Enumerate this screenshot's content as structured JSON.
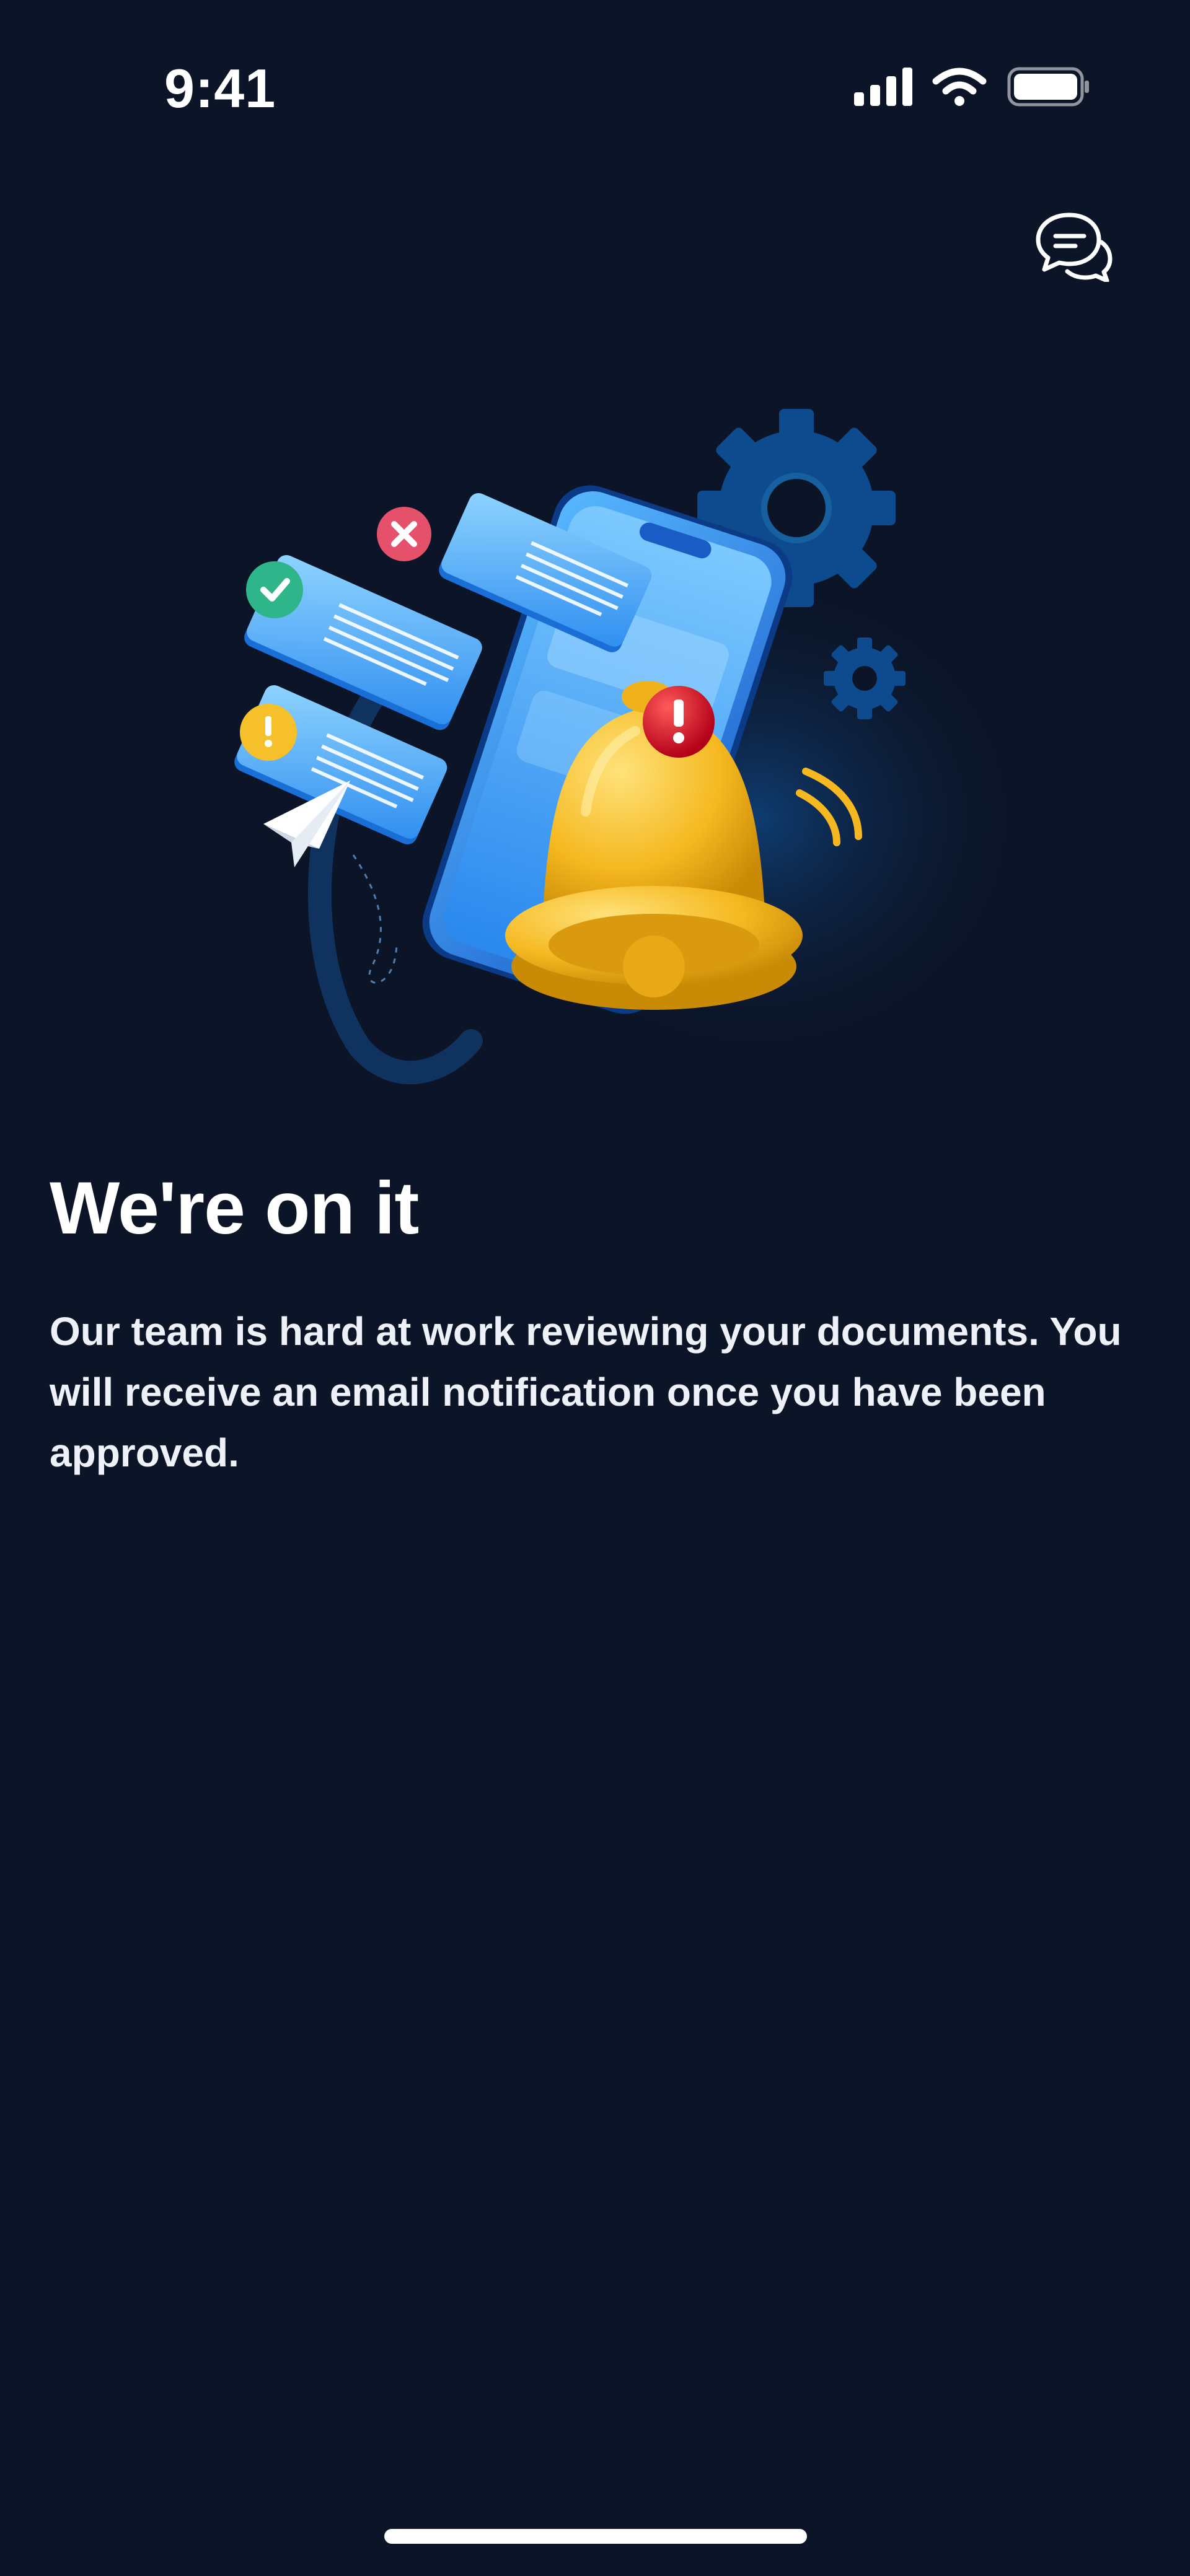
{
  "status_bar": {
    "time": "9:41",
    "icons": [
      "cellular-signal-icon",
      "wifi-icon",
      "battery-icon"
    ]
  },
  "header": {
    "chat_icon": "chat-bubbles-icon"
  },
  "illustration": {
    "subject": "notification-bell-phone-illustration",
    "elements": [
      "phone",
      "bell",
      "alert-badge",
      "message-cards",
      "status-check-icon",
      "status-cross-icon",
      "status-warning-icon",
      "paper-plane",
      "gears"
    ]
  },
  "content": {
    "title": "We're on it",
    "body": "Our team is hard at work reviewing your documents. You will receive an email notification once you have been approved."
  },
  "colors": {
    "background": "#0c1427",
    "accent_blue": "#3aa0f5",
    "bell_yellow": "#f5b820",
    "alert_red": "#d9122a",
    "check_green": "#2fb58a"
  }
}
